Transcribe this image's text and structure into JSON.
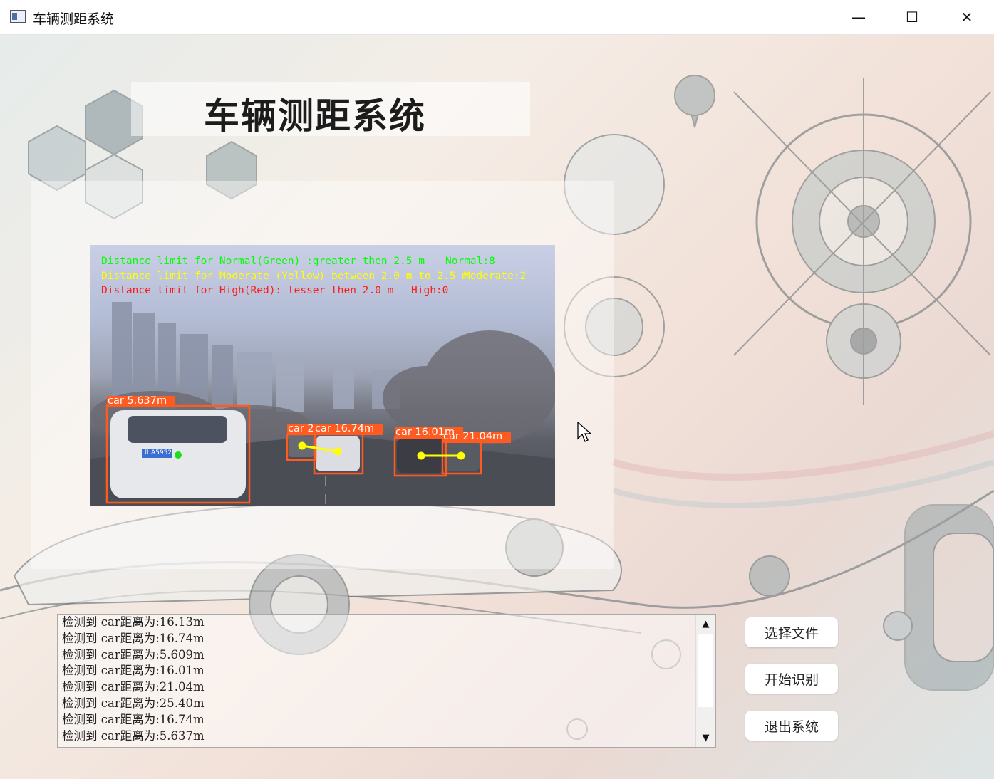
{
  "window": {
    "title": "车辆测距系统",
    "minimize_glyph": "—",
    "maximize_glyph": "☐",
    "close_glyph": "✕"
  },
  "header": {
    "title": "车辆测距系统"
  },
  "video": {
    "line_normal": "Distance limit for Normal(Green) :greater then 2.5 m",
    "count_normal": "Normal:8",
    "line_moderate": "Distance limit for Moderate (Yellow) between 2.0 m to 2.5 m",
    "count_moderate": "Moderate:2",
    "line_high": "Distance limit for High(Red): lesser then 2.0 m",
    "count_high": "High:0",
    "plate": "川A5952",
    "labels": [
      "car 5.637m",
      "car 2",
      "car 16.74m",
      "car 16.01m",
      "car 21.04m"
    ],
    "colors": {
      "normal": "#00ff00",
      "moderate": "#ffff00",
      "high": "#ff0000",
      "box": "#ff5a1f"
    }
  },
  "log": {
    "lines": [
      "检测到 car距离为:16.13m",
      "检测到 car距离为:16.74m",
      "检测到 car距离为:5.609m",
      "检测到 car距离为:16.01m",
      "检测到 car距离为:21.04m",
      "检测到 car距离为:25.40m",
      "检测到 car距离为:16.74m",
      "检测到 car距离为:5.637m"
    ],
    "scroll_up_glyph": "▲",
    "scroll_down_glyph": "▼"
  },
  "buttons": {
    "select_file": "选择文件",
    "start_recognition": "开始识别",
    "exit_system": "退出系统"
  }
}
